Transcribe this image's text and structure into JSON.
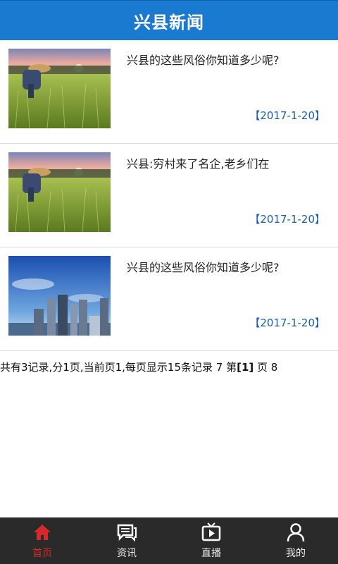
{
  "header": {
    "title": "兴县新闻"
  },
  "news": [
    {
      "title": "兴县的这些风俗你知道多少呢?",
      "date": "【2017-1-20】",
      "image": "farmer-field"
    },
    {
      "title": "兴县:穷村来了名企,老乡们在",
      "date": "【2017-1-20】",
      "image": "farmer-field"
    },
    {
      "title": "兴县的这些风俗你知道多少呢?",
      "date": "【2017-1-20】",
      "image": "city-skyline"
    }
  ],
  "pager": {
    "text_before": "共有3记录,分1页,当前页1,每页显示15条记录 7 第",
    "current": "[1]",
    "text_after": " 页 8"
  },
  "tabs": [
    {
      "label": "首页",
      "icon": "home-icon",
      "active": true
    },
    {
      "label": "资讯",
      "icon": "chat-icon",
      "active": false
    },
    {
      "label": "直播",
      "icon": "tv-icon",
      "active": false
    },
    {
      "label": "我的",
      "icon": "user-icon",
      "active": false
    }
  ],
  "colors": {
    "header_bg": "#1a7ad0",
    "date_text": "#1a5fa8",
    "tab_active": "#d42a2a",
    "tabbar_bg": "#2a2a2a"
  }
}
